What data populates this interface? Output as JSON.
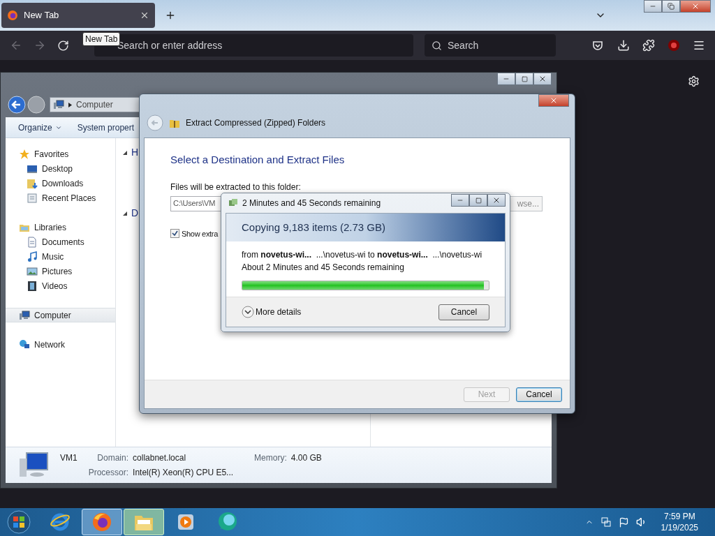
{
  "browser": {
    "tabs": [
      {
        "label": "New Tab",
        "selected": true
      }
    ],
    "tooltip": "New Tab",
    "address": {
      "placeholder": "Search or enter address"
    },
    "search": {
      "placeholder": "Search"
    }
  },
  "explorer": {
    "breadcrumb": [
      "Computer"
    ],
    "toolbar": [
      {
        "label": "Organize",
        "dropdown": true
      },
      {
        "label": "System propert",
        "dropdown": false
      }
    ],
    "nav": [
      {
        "label": "Favorites",
        "kind": "star",
        "selected": false,
        "children": [
          {
            "label": "Desktop",
            "kind": "desktop",
            "selected": false
          },
          {
            "label": "Downloads",
            "kind": "downloads",
            "selected": false
          },
          {
            "label": "Recent Places",
            "kind": "recent",
            "selected": false
          }
        ]
      },
      {
        "label": "Libraries",
        "kind": "library",
        "selected": false,
        "children": [
          {
            "label": "Documents",
            "kind": "documents",
            "selected": false
          },
          {
            "label": "Music",
            "kind": "music",
            "selected": false
          },
          {
            "label": "Pictures",
            "kind": "pictures",
            "selected": false
          },
          {
            "label": "Videos",
            "kind": "videos",
            "selected": false
          }
        ]
      },
      {
        "label": "Computer",
        "kind": "computer",
        "selected": true
      },
      {
        "label": "Network",
        "kind": "network",
        "selected": false
      }
    ],
    "headings": [
      "H",
      "D"
    ],
    "details": {
      "name": "VM1",
      "fields": [
        {
          "label": "Domain:",
          "value": "collabnet.local"
        },
        {
          "label": "Processor:",
          "value": "Intel(R) Xeon(R) CPU E5..."
        }
      ],
      "memory": {
        "label": "Memory:",
        "value": "4.00 GB"
      }
    }
  },
  "extract_dialog": {
    "title": "Extract Compressed (Zipped) Folders",
    "heading": "Select a Destination and Extract Files",
    "folder_label": "Files will be extracted to this folder:",
    "folder_value": "C:\\Users\\VM",
    "browse": "wse...",
    "show_checkbox": {
      "label": "Show extra",
      "checked": true
    },
    "buttons": [
      {
        "label": "Next",
        "disabled": true,
        "default": false
      },
      {
        "label": "Cancel",
        "disabled": false,
        "default": true
      }
    ]
  },
  "copy_dialog": {
    "title": "2 Minutes and 45 Seconds remaining",
    "heading": "Copying 9,183 items (2.73 GB)",
    "from_line": "from **novetus-wi...**  ...\\novetus-wi to **novetus-wi...**  ...\\novetus-wi",
    "status": "About 2 Minutes and 45 Seconds remaining",
    "progress": {
      "level": 0.98
    },
    "more_details": "More details",
    "cancel": "Cancel"
  },
  "taskbar": {
    "apps": [
      {
        "kind": "ie",
        "selected": false
      },
      {
        "kind": "firefox",
        "selected": true
      },
      {
        "kind": "folder",
        "selected": true
      },
      {
        "kind": "media",
        "selected": false
      },
      {
        "kind": "bubble",
        "selected": false
      }
    ],
    "clock": {
      "time": "7:59 PM",
      "date": "1/19/2025"
    }
  }
}
